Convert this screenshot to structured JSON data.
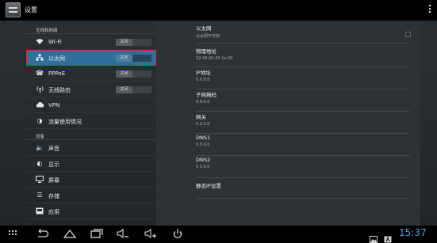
{
  "action_bar": {
    "title": "设置"
  },
  "sidebar": {
    "sections": [
      {
        "header": "无线和网络",
        "items": [
          {
            "label": "Wi-Fi",
            "icon": "wifi-icon",
            "toggle": "关闭",
            "active": false
          },
          {
            "label": "以太网",
            "icon": "ethernet-icon",
            "toggle": "关闭",
            "active": true
          },
          {
            "label": "PPPoE",
            "icon": "phone-icon",
            "toggle": "关闭",
            "active": false
          },
          {
            "label": "无线路由",
            "icon": "hotspot-icon",
            "toggle": "关闭",
            "active": false
          },
          {
            "label": "VPN",
            "icon": "cloud-icon",
            "toggle": null,
            "active": false
          },
          {
            "label": "流量使用情况",
            "icon": "data-usage-icon",
            "toggle": null,
            "active": false
          }
        ]
      },
      {
        "header": "设备",
        "items": [
          {
            "label": "声音",
            "icon": "speaker-icon",
            "toggle": null,
            "active": false
          },
          {
            "label": "显示",
            "icon": "brightness-icon",
            "toggle": null,
            "active": false
          },
          {
            "label": "屏幕",
            "icon": "monitor-icon",
            "toggle": null,
            "active": false
          },
          {
            "label": "存储",
            "icon": "storage-icon",
            "toggle": null,
            "active": false
          },
          {
            "label": "应用",
            "icon": "apps-icon",
            "toggle": null,
            "active": false
          }
        ]
      }
    ]
  },
  "details": {
    "ethernet": {
      "title": "以太网",
      "subtitle": "以太网不可用",
      "checked": false
    },
    "mac": {
      "title": "物理地址",
      "value": "52:48:05:35:1e:00"
    },
    "ip": {
      "title": "IP地址",
      "value": "0.0.0.0"
    },
    "netmask": {
      "title": "子网掩码",
      "value": "0.0.0.0"
    },
    "gateway": {
      "title": "网关",
      "value": "0.0.0.0"
    },
    "dns1": {
      "title": "DNS1",
      "value": "0.0.0.0"
    },
    "dns2": {
      "title": "DNS2",
      "value": "0.0.0.0"
    },
    "static_ip": {
      "title": "静态IP设置"
    }
  },
  "navbar": {
    "clock": "15:37"
  },
  "colors": {
    "accent": "#2f6f99",
    "clock": "#38a6e0",
    "highlight_border": "#d43030"
  }
}
